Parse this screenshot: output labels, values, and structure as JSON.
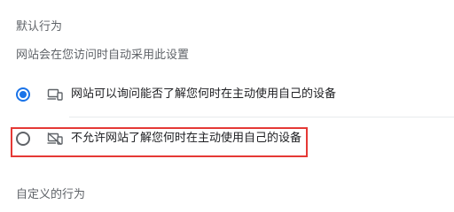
{
  "default_behavior": {
    "title": "默认行为",
    "description": "网站会在您访问时自动采用此设置",
    "options": [
      {
        "label": "网站可以询问能否了解您何时在主动使用自己的设备",
        "selected": true,
        "icon": "device-icon"
      },
      {
        "label": "不允许网站了解您何时在主动使用自己的设备",
        "selected": false,
        "icon": "device-off-icon"
      }
    ]
  },
  "custom_behavior": {
    "title": "自定义的行为"
  },
  "colors": {
    "accent": "#1a73e8",
    "highlight": "#e53935"
  }
}
